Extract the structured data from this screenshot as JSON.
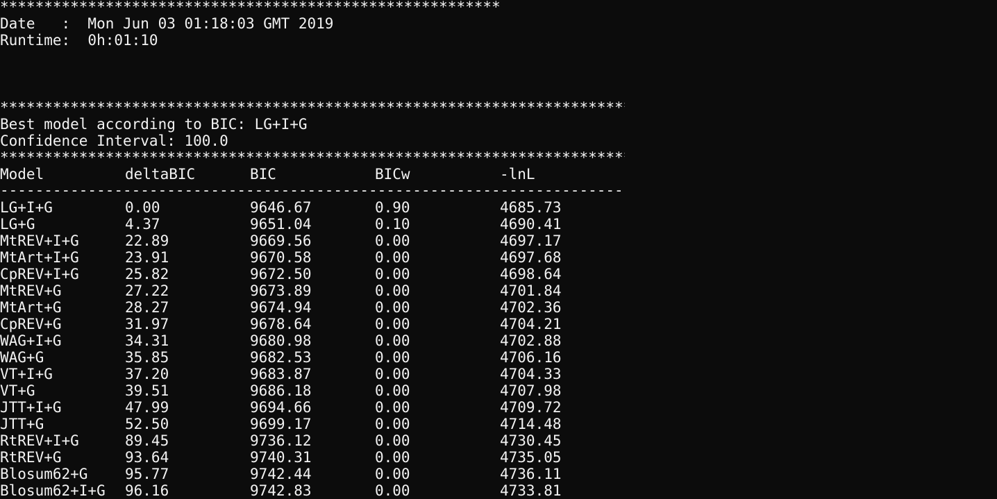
{
  "header_stars_1": "************************************************************",
  "date_line": "Date   :  Mon Jun 03 01:18:03 GMT 2019",
  "runtime_line": "Runtime:  0h:01:10",
  "stars_2": "***************************************************************************",
  "best_model_line": "Best model according to BIC: LG+I+G",
  "confidence_line": "Confidence Interval: 100.0",
  "stars_3": "***************************************************************************",
  "table": {
    "headers": [
      "Model",
      "deltaBIC",
      "BIC",
      "BICw",
      "-lnL"
    ],
    "separator": "---------------------------------------------------------------------------",
    "rows": [
      [
        "LG+I+G",
        "0.00",
        "9646.67",
        "0.90",
        "4685.73"
      ],
      [
        "LG+G",
        "4.37",
        "9651.04",
        "0.10",
        "4690.41"
      ],
      [
        "MtREV+I+G",
        "22.89",
        "9669.56",
        "0.00",
        "4697.17"
      ],
      [
        "MtArt+I+G",
        "23.91",
        "9670.58",
        "0.00",
        "4697.68"
      ],
      [
        "CpREV+I+G",
        "25.82",
        "9672.50",
        "0.00",
        "4698.64"
      ],
      [
        "MtREV+G",
        "27.22",
        "9673.89",
        "0.00",
        "4701.84"
      ],
      [
        "MtArt+G",
        "28.27",
        "9674.94",
        "0.00",
        "4702.36"
      ],
      [
        "CpREV+G",
        "31.97",
        "9678.64",
        "0.00",
        "4704.21"
      ],
      [
        "WAG+I+G",
        "34.31",
        "9680.98",
        "0.00",
        "4702.88"
      ],
      [
        "WAG+G",
        "35.85",
        "9682.53",
        "0.00",
        "4706.16"
      ],
      [
        "VT+I+G",
        "37.20",
        "9683.87",
        "0.00",
        "4704.33"
      ],
      [
        "VT+G",
        "39.51",
        "9686.18",
        "0.00",
        "4707.98"
      ],
      [
        "JTT+I+G",
        "47.99",
        "9694.66",
        "0.00",
        "4709.72"
      ],
      [
        "JTT+G",
        "52.50",
        "9699.17",
        "0.00",
        "4714.48"
      ],
      [
        "RtREV+I+G",
        "89.45",
        "9736.12",
        "0.00",
        "4730.45"
      ],
      [
        "RtREV+G",
        "93.64",
        "9740.31",
        "0.00",
        "4735.05"
      ],
      [
        "Blosum62+G",
        "95.77",
        "9742.44",
        "0.00",
        "4736.11"
      ],
      [
        "Blosum62+I+G",
        "96.16",
        "9742.83",
        "0.00",
        "4733.81"
      ]
    ]
  }
}
